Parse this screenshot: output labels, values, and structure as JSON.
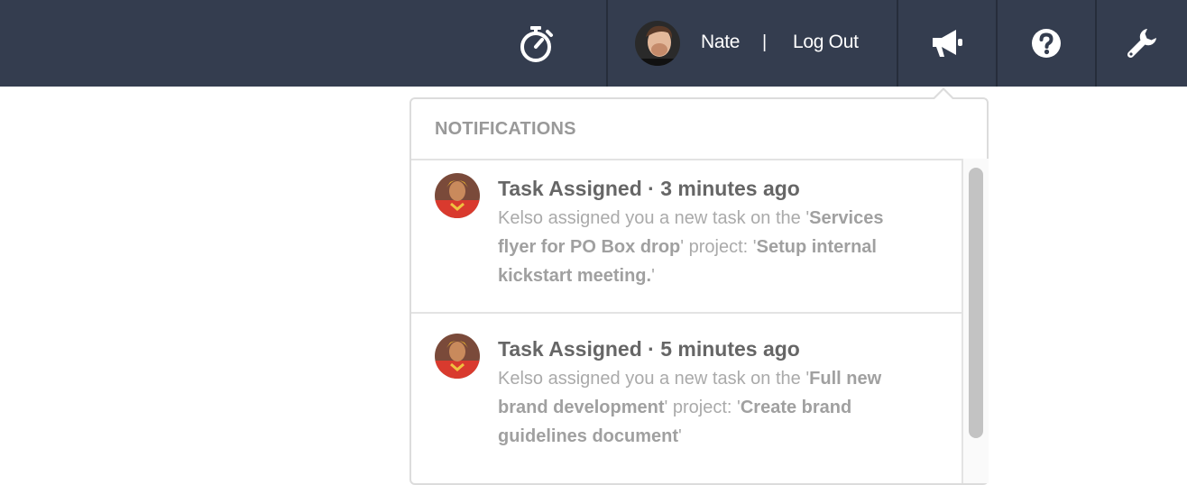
{
  "header": {
    "user": {
      "name": "Nate",
      "separator": "|",
      "logout_label": "Log Out"
    },
    "icons": [
      "stopwatch-icon",
      "megaphone-icon",
      "help-icon",
      "wrench-icon"
    ],
    "colors": {
      "bar": "#343d4f",
      "divider": "#262d3b"
    }
  },
  "notifications": {
    "title": "NOTIFICATIONS",
    "items": [
      {
        "heading": "Task Assigned · 3 minutes ago",
        "text_before": "Kelso assigned you a new task on the ",
        "project": "Services flyer for PO Box drop",
        "text_middle": " project: ",
        "task": "Setup internal kickstart meeting."
      },
      {
        "heading": "Task Assigned · 5 minutes ago",
        "text_before": "Kelso assigned you a new task on the ",
        "project": "Full new brand development",
        "text_middle": " project: ",
        "task": "Create brand guidelines document"
      }
    ]
  }
}
